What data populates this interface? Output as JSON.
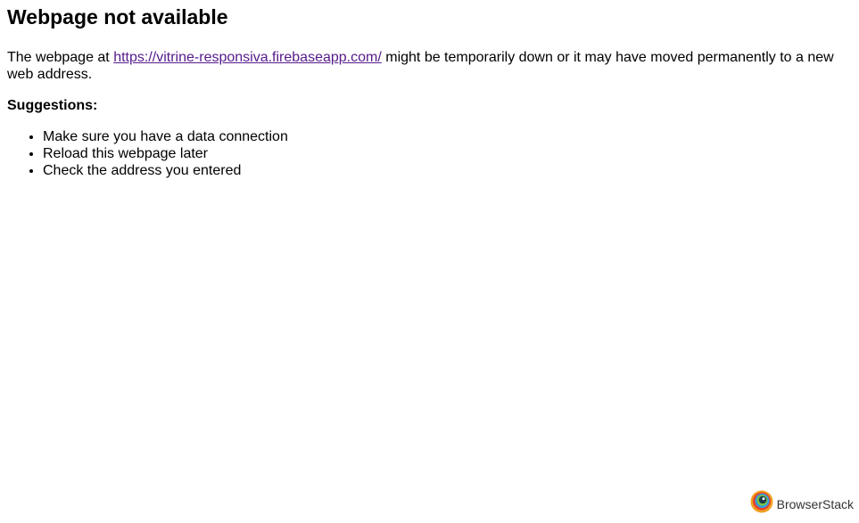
{
  "page": {
    "title": "Webpage not available",
    "message_prefix": "The webpage at ",
    "url": "https://vitrine-responsiva.firebaseapp.com/",
    "message_suffix": " might be temporarily down or it may have moved permanently to a new web address.",
    "suggestions_heading": "Suggestions:",
    "suggestions": [
      "Make sure you have a data connection",
      "Reload this webpage later",
      "Check the address you entered"
    ]
  },
  "footer": {
    "brand": "BrowserStack",
    "logo_icon": "browserstack-logo-icon"
  },
  "colors": {
    "link": "#551a8b",
    "text": "#000000",
    "background": "#ffffff"
  }
}
